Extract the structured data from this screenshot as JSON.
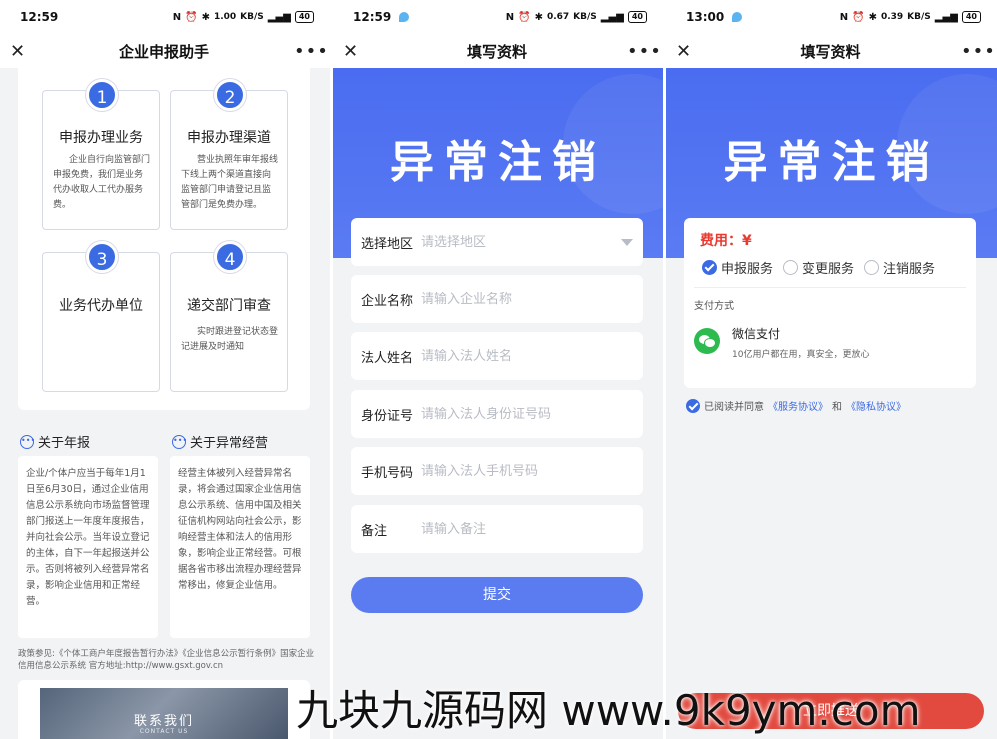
{
  "status": [
    {
      "time": "12:59",
      "net": "1.00",
      "net_unit": "KB/S",
      "battery": "40"
    },
    {
      "time": "12:59",
      "net": "0.67",
      "net_unit": "KB/S",
      "battery": "40"
    },
    {
      "time": "13:00",
      "net": "0.39",
      "net_unit": "KB/S",
      "battery": "40"
    }
  ],
  "icons": {
    "close": "close-icon",
    "more": "more-icon",
    "info": "info-icon",
    "dropdown": "chevron-down-icon",
    "wechat": "wechat-icon",
    "check": "check-icon"
  },
  "panel1": {
    "title": "企业申报助手",
    "steps": [
      {
        "num": "1",
        "title": "申报办理业务",
        "desc": "企业自行向监管部门申报免费，我们是业务代办收取人工代办服务费。"
      },
      {
        "num": "2",
        "title": "申报办理渠道",
        "desc": "营业执照年审年报线下线上两个渠道直接向监管部门申请登记且监管部门是免费办理。"
      },
      {
        "num": "3",
        "title": "业务代办单位",
        "desc": ""
      },
      {
        "num": "4",
        "title": "递交部门审查",
        "desc": "实时跟进登记状态登记进展及时通知"
      }
    ],
    "info": [
      {
        "title": "关于年报",
        "text": "企业/个体户应当于每年1月1日至6月30日，通过企业信用信息公示系统向市场监督管理部门报送上一年度年度报告，并向社会公示。当年设立登记的主体，自下一年起报送并公示。否则将被列入经营异常名录，影响企业信用和正常经营。"
      },
      {
        "title": "关于异常经营",
        "text": "经营主体被列入经营异常名录，将会通过国家企业信用信息公示系统、信用中国及相关征信机构网站向社会公示，影响经营主体和法人的信用形象，影响企业正常经营。可根据各省市移出流程办理经营异常移出，修复企业信用。"
      }
    ],
    "policy": "政策参见:《个体工商户年度报告暂行办法》《企业信息公示暂行条例》国家企业信用信息公示系统 官方地址:http://www.gsxt.gov.cn",
    "contact_title": "联系我们",
    "contact_sub": "CONTACT US"
  },
  "panel2": {
    "title": "填写资料",
    "banner": "异常注销",
    "fields": [
      {
        "label": "选择地区",
        "placeholder": "请选择地区"
      },
      {
        "label": "企业名称",
        "placeholder": "请输入企业名称"
      },
      {
        "label": "法人姓名",
        "placeholder": "请输入法人姓名"
      },
      {
        "label": "身份证号",
        "placeholder": "请输入法人身份证号码"
      },
      {
        "label": "手机号码",
        "placeholder": "请输入法人手机号码"
      },
      {
        "label": "备注",
        "placeholder": "请输入备注"
      }
    ],
    "submit": "提交"
  },
  "panel3": {
    "title": "填写资料",
    "banner": "异常注销",
    "fee": "费用：¥",
    "services": [
      {
        "label": "申报服务",
        "selected": true
      },
      {
        "label": "变更服务",
        "selected": false
      },
      {
        "label": "注销服务",
        "selected": false
      }
    ],
    "pay_label": "支付方式",
    "wechat_name": "微信支付",
    "wechat_desc": "10亿用户都在用，真安全，更放心",
    "agree_prefix": "已阅读并同意",
    "agree_link1": "《服务协议》",
    "agree_and": "和",
    "agree_link2": "《隐私协议》",
    "pay_button": "立即推送"
  },
  "watermark": "九块九源码网 www.9k9ym.com",
  "colors": {
    "accent": "#3b6be3",
    "banner": "#4a6cf0",
    "fee": "#e83a2f",
    "pay_button": "#e24a3f",
    "wechat": "#2dbb4f"
  }
}
